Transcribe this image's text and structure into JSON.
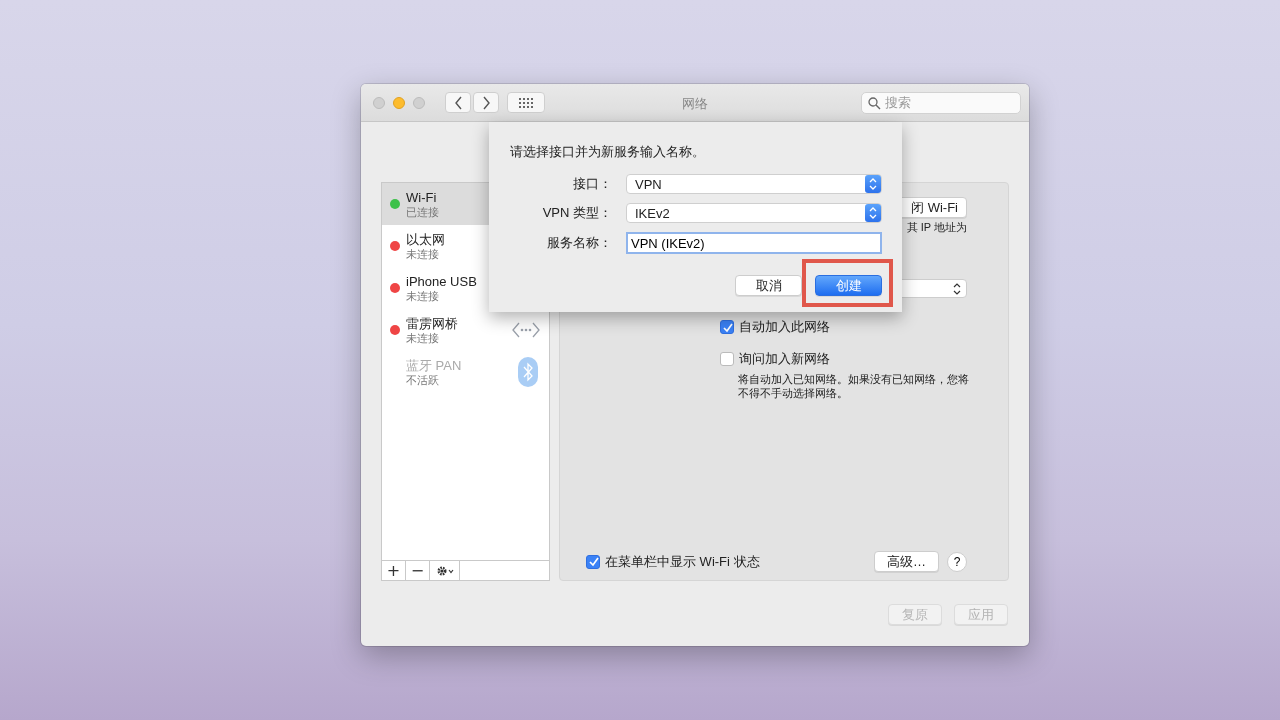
{
  "window": {
    "title": "网络",
    "search": {
      "placeholder": "搜索"
    },
    "traffic_lights": [
      {
        "kind": "close",
        "active": false
      },
      {
        "kind": "minimize",
        "active": true
      },
      {
        "kind": "zoom",
        "active": false
      }
    ]
  },
  "sidebar": {
    "items": [
      {
        "name": "Wi-Fi",
        "status": "已连接",
        "color": "#3dc14a",
        "selected": true,
        "disabled": false,
        "kind": "wifi"
      },
      {
        "name": "以太网",
        "status": "未连接",
        "color": "#ef4545",
        "selected": false,
        "disabled": false,
        "kind": "ethernet"
      },
      {
        "name": "iPhone USB",
        "status": "未连接",
        "color": "#ef4545",
        "selected": false,
        "disabled": false,
        "kind": "usb"
      },
      {
        "name": "雷雳网桥",
        "status": "未连接",
        "color": "#ef4545",
        "selected": false,
        "disabled": false,
        "kind": "bridge"
      },
      {
        "name": "蓝牙 PAN",
        "status": "不活跃",
        "selected": false,
        "disabled": true,
        "kind": "bluetooth"
      }
    ],
    "buttons": [
      "+",
      "−"
    ]
  },
  "panel": {
    "wifi_button": "闭 Wi-Fi",
    "ip_text": "其 IP 地址为",
    "checkboxes": [
      {
        "label": "自动加入此网络",
        "checked": true
      },
      {
        "label": "询问加入新网络",
        "checked": false
      }
    ],
    "note": "将自动加入已知网络。如果没有已知网络，您将不得不手动选择网络。",
    "menubar_checkbox": {
      "label": "在菜单栏中显示 Wi-Fi 状态",
      "checked": true
    },
    "advanced_button": "高级…",
    "help_button": "?"
  },
  "footer_buttons": [
    {
      "label": "复原",
      "disabled": true
    },
    {
      "label": "应用",
      "disabled": true
    }
  ],
  "sheet": {
    "prompt": "请选择接口并为新服务输入名称。",
    "fields": [
      {
        "kind": "popup",
        "label": "接口：",
        "value": "VPN"
      },
      {
        "kind": "popup",
        "label": "VPN 类型：",
        "value": "IKEv2"
      },
      {
        "kind": "text",
        "label": "服务名称：",
        "value": "VPN (IKEv2)"
      }
    ],
    "buttons": [
      {
        "label": "取消",
        "default": false
      },
      {
        "label": "创建",
        "default": true
      }
    ]
  }
}
